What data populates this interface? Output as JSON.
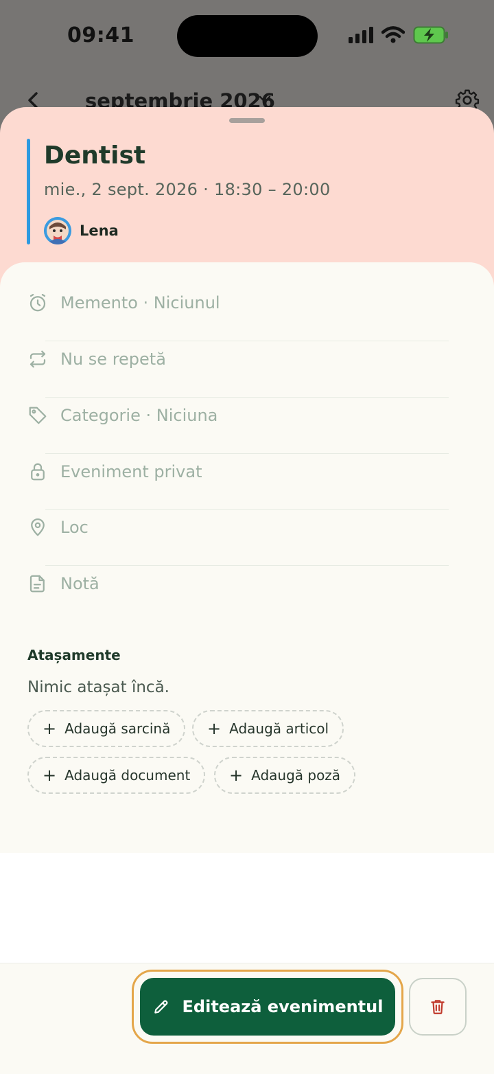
{
  "status_bar": {
    "time": "09:41"
  },
  "background_nav": {
    "month_title": "septembrie 2026"
  },
  "event": {
    "title": "Dentist",
    "date_time": "mie., 2 sept. 2026 · 18:30 – 20:00",
    "attendee": "Lena",
    "color": "#2d9ae0"
  },
  "details": [
    {
      "icon": "alarm-icon",
      "label": "Memento · Niciunul"
    },
    {
      "icon": "repeat-icon",
      "label": "Nu se repetă"
    },
    {
      "icon": "tag-icon",
      "label": "Categorie · Niciuna"
    },
    {
      "icon": "lock-icon",
      "label": "Eveniment privat"
    },
    {
      "icon": "location-pin-icon",
      "label": "Loc"
    },
    {
      "icon": "note-icon",
      "label": "Notă"
    }
  ],
  "attachments": {
    "title": "Atașamente",
    "empty_text": "Nimic atașat încă.",
    "add_task": "Adaugă sarcină",
    "add_item": "Adaugă articol",
    "add_document": "Adaugă document",
    "add_photo": "Adaugă poză"
  },
  "actions": {
    "edit_label": "Editează evenimentul",
    "primary_color": "#0e5f3c",
    "delete_color": "#c0392b"
  }
}
